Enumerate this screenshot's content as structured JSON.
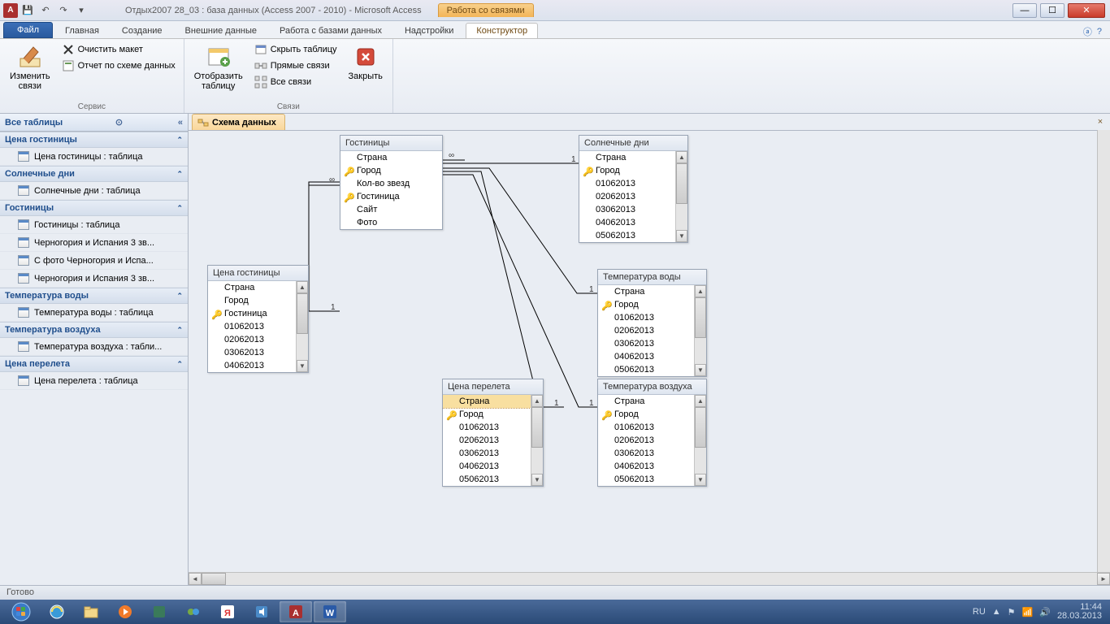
{
  "title": "Отдых2007 28_03 : база данных (Access 2007 - 2010)  -  Microsoft Access",
  "contextual_tab_group": "Работа со связями",
  "tabs": {
    "file": "Файл",
    "home": "Главная",
    "create": "Создание",
    "external": "Внешние данные",
    "dbtools": "Работа с базами данных",
    "addins": "Надстройки",
    "design": "Конструктор"
  },
  "ribbon": {
    "group_service": "Сервис",
    "group_links": "Связи",
    "edit_links": "Изменить\nсвязи",
    "clear_layout": "Очистить макет",
    "rel_report": "Отчет по схеме данных",
    "show_table": "Отобразить\nтаблицу",
    "hide_table": "Скрыть таблицу",
    "direct_links": "Прямые связи",
    "all_links": "Все связи",
    "close": "Закрыть"
  },
  "nav": {
    "header": "Все таблицы",
    "groups": [
      {
        "title": "Цена гостиницы",
        "items": [
          "Цена гостиницы : таблица"
        ]
      },
      {
        "title": "Солнечные дни",
        "items": [
          "Солнечные дни : таблица"
        ]
      },
      {
        "title": "Гостиницы",
        "items": [
          "Гостиницы : таблица",
          "Черногория и Испания 3 зв...",
          "С фото Черногория и Испа...",
          "Черногория и Испания 3 зв..."
        ]
      },
      {
        "title": "Температура воды",
        "items": [
          "Температура воды : таблица"
        ]
      },
      {
        "title": "Температура воздуха",
        "items": [
          "Температура воздуха : табли..."
        ]
      },
      {
        "title": "Цена перелета",
        "items": [
          "Цена перелета : таблица"
        ]
      }
    ]
  },
  "doc_tab": "Схема данных",
  "tables": {
    "gost": {
      "title": "Гостиницы",
      "fields": [
        {
          "n": "Страна",
          "k": false
        },
        {
          "n": "Город",
          "k": true
        },
        {
          "n": "Кол-во звезд",
          "k": false
        },
        {
          "n": "Гостиница",
          "k": true
        },
        {
          "n": "Сайт",
          "k": false
        },
        {
          "n": "Фото",
          "k": false
        }
      ]
    },
    "sunny": {
      "title": "Солнечные дни",
      "fields": [
        {
          "n": "Страна",
          "k": false
        },
        {
          "n": "Город",
          "k": true
        },
        {
          "n": "01062013",
          "k": false
        },
        {
          "n": "02062013",
          "k": false
        },
        {
          "n": "03062013",
          "k": false
        },
        {
          "n": "04062013",
          "k": false
        },
        {
          "n": "05062013",
          "k": false
        }
      ]
    },
    "price_hotel": {
      "title": "Цена гостиницы",
      "fields": [
        {
          "n": "Страна",
          "k": false
        },
        {
          "n": "Город",
          "k": false
        },
        {
          "n": "Гостиница",
          "k": true
        },
        {
          "n": "01062013",
          "k": false
        },
        {
          "n": "02062013",
          "k": false
        },
        {
          "n": "03062013",
          "k": false
        },
        {
          "n": "04062013",
          "k": false
        }
      ]
    },
    "temp_water": {
      "title": "Температура воды",
      "fields": [
        {
          "n": "Страна",
          "k": false
        },
        {
          "n": "Город",
          "k": true
        },
        {
          "n": "01062013",
          "k": false
        },
        {
          "n": "02062013",
          "k": false
        },
        {
          "n": "03062013",
          "k": false
        },
        {
          "n": "04062013",
          "k": false
        },
        {
          "n": "05062013",
          "k": false
        }
      ]
    },
    "price_flight": {
      "title": "Цена перелета",
      "fields": [
        {
          "n": "Страна",
          "k": false,
          "sel": true
        },
        {
          "n": "Город",
          "k": true
        },
        {
          "n": "01062013",
          "k": false
        },
        {
          "n": "02062013",
          "k": false
        },
        {
          "n": "03062013",
          "k": false
        },
        {
          "n": "04062013",
          "k": false
        },
        {
          "n": "05062013",
          "k": false
        }
      ]
    },
    "temp_air": {
      "title": "Температура воздуха",
      "fields": [
        {
          "n": "Страна",
          "k": false
        },
        {
          "n": "Город",
          "k": true
        },
        {
          "n": "01062013",
          "k": false
        },
        {
          "n": "02062013",
          "k": false
        },
        {
          "n": "03062013",
          "k": false
        },
        {
          "n": "04062013",
          "k": false
        },
        {
          "n": "05062013",
          "k": false
        }
      ]
    }
  },
  "rel_labels": {
    "one": "1",
    "many": "∞"
  },
  "status": "Готово",
  "tray": {
    "lang": "RU",
    "time": "11:44",
    "date": "28.03.2013"
  }
}
